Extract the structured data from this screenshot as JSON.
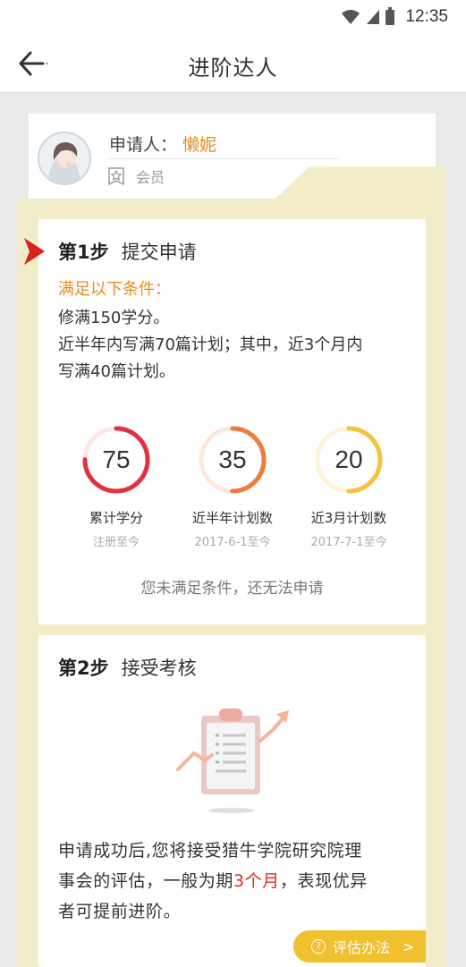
{
  "status_bar": {
    "time": "12:35",
    "icons": [
      "wifi-icon",
      "signal-icon",
      "battery-icon"
    ]
  },
  "nav": {
    "title": "进阶达人",
    "back_icon": "back-arrow-icon"
  },
  "profile": {
    "applicant_label": "申请人：",
    "applicant_name": "懒妮",
    "member_label": "会员",
    "member_icon": "star-badge-icon"
  },
  "step1": {
    "number": "第1步",
    "title": "提交申请",
    "conditions_title": "满足以下条件：",
    "conditions": [
      "修满150学分。",
      "近半年内写满70篇计划；其中，近3个月内",
      "写满40篇计划。"
    ],
    "gauges": [
      {
        "value": "75",
        "label": "累计学分",
        "sub": "注册至今",
        "fraction": 0.75,
        "color": "#e2303f"
      },
      {
        "value": "35",
        "label": "近半年计划数",
        "sub": "2017-6-1至今",
        "fraction": 0.5,
        "color": "#f07a3c"
      },
      {
        "value": "20",
        "label": "近3月计划数",
        "sub": "2017-7-1至今",
        "fraction": 0.5,
        "color": "#f4c43a"
      }
    ],
    "note": "您未满足条件，还无法申请"
  },
  "step2": {
    "number": "第2步",
    "title": "接受考核",
    "illustration_icon": "clipboard-chart-icon",
    "lines": [
      {
        "before": "申请成功后,您将接受猎牛学院研究院理",
        "highlight": "",
        "after": ""
      },
      {
        "before": "事会的评估，一般为期",
        "highlight": "3个月",
        "after": "，表现优异"
      },
      {
        "before": "者可提前进阶。",
        "highlight": "",
        "after": ""
      }
    ]
  },
  "eval_button": {
    "label": "评估办法",
    "icon": "question-circle-icon",
    "chevron": ">"
  },
  "colors": {
    "accent_orange": "#e58b1e",
    "panel_yellow": "#f3ecc9",
    "highlight_red": "#e02b24",
    "button_yellow": "#f1c02f"
  }
}
